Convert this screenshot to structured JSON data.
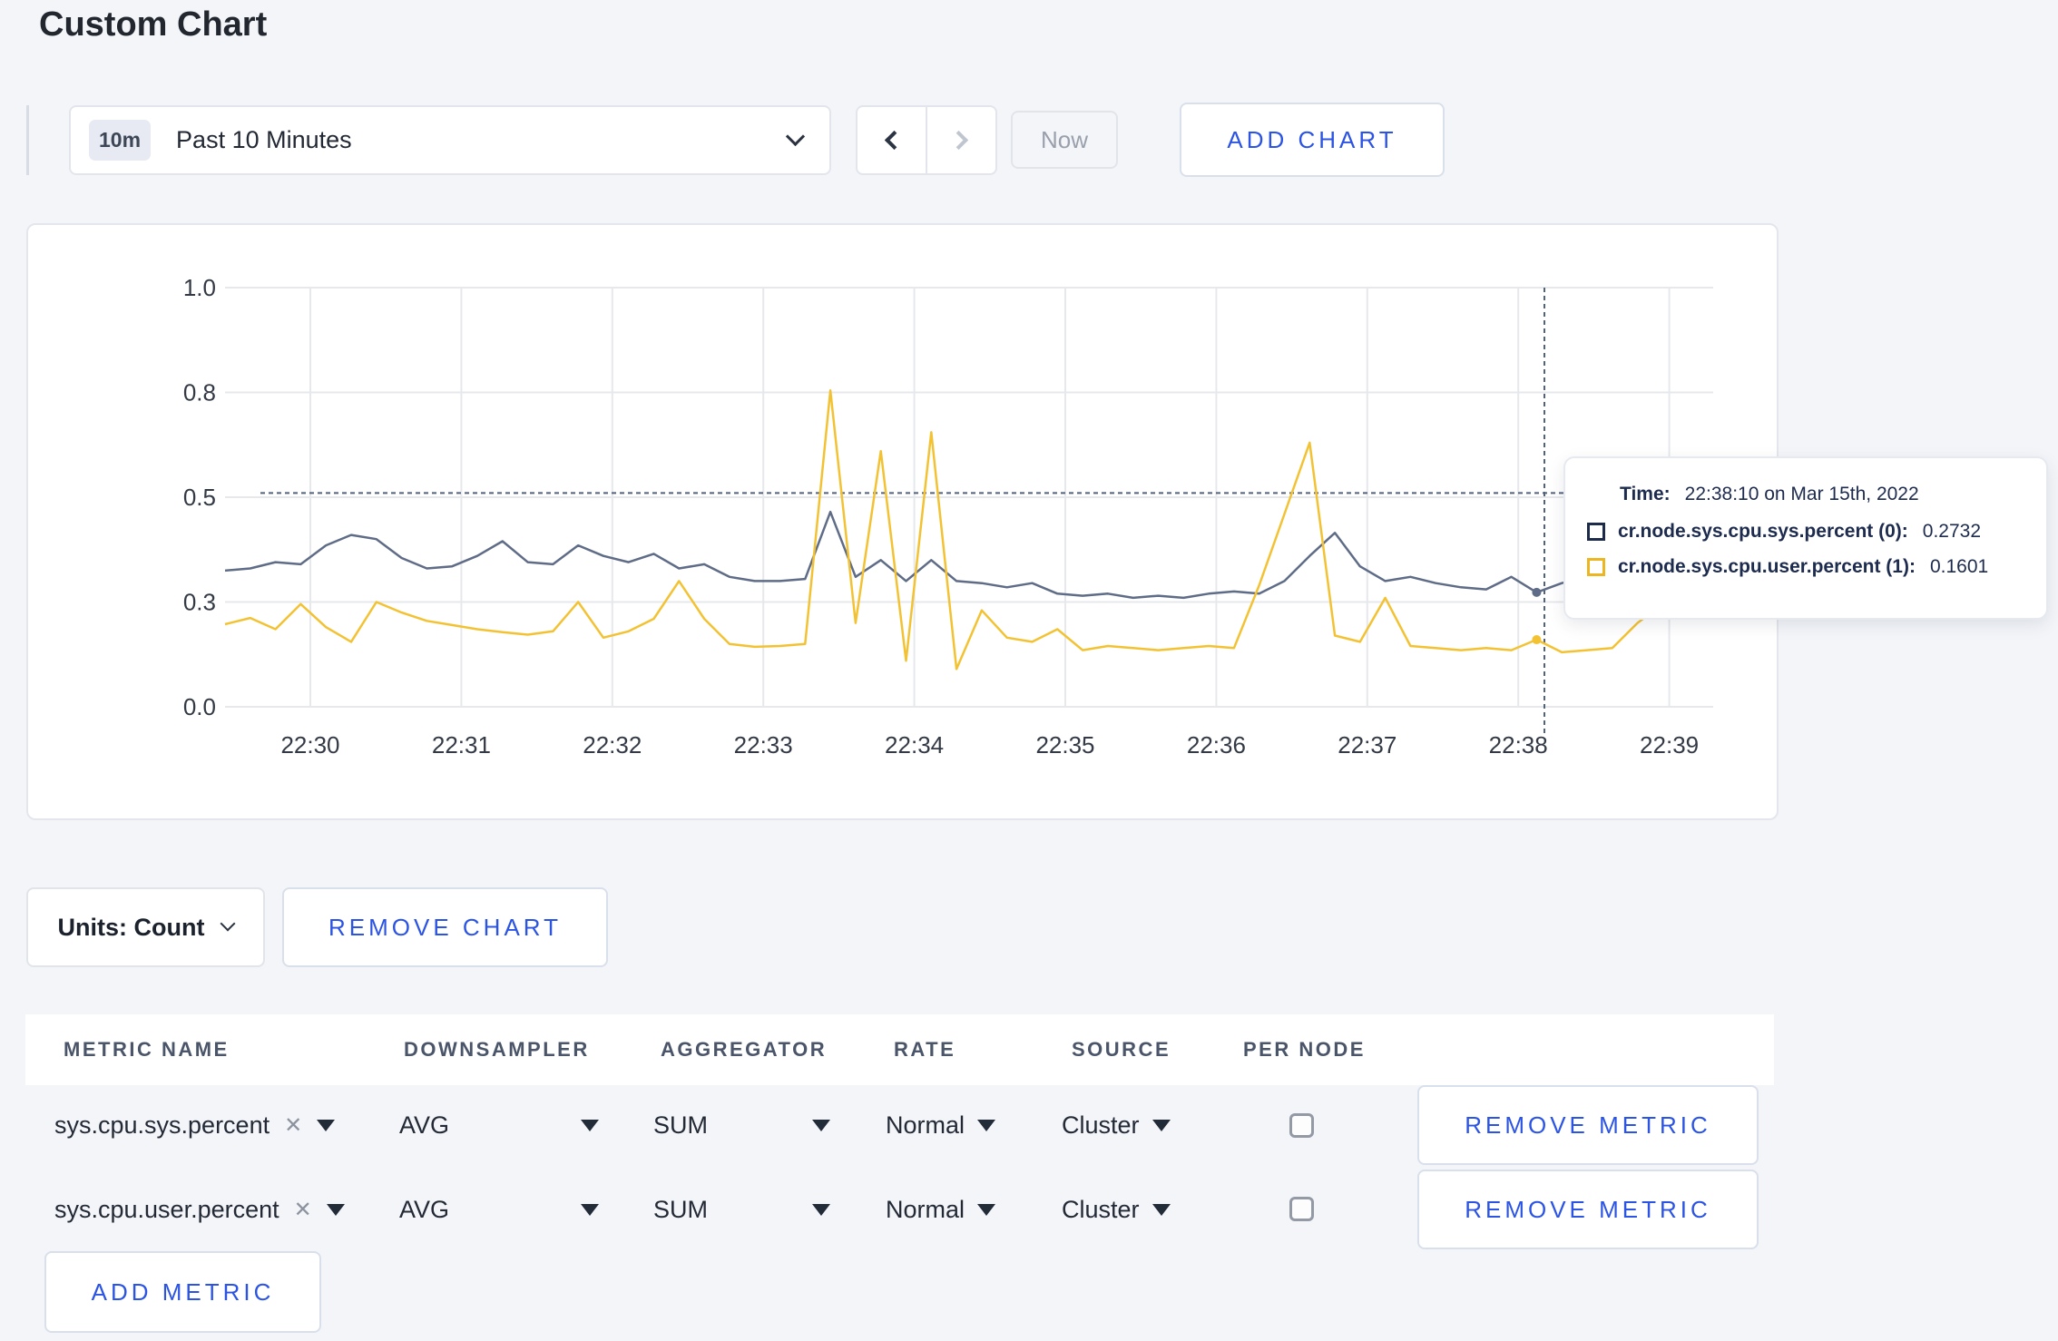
{
  "page": {
    "title": "Custom Chart"
  },
  "toolbar": {
    "time_range": {
      "badge": "10m",
      "label": "Past 10 Minutes"
    },
    "now_label": "Now",
    "add_chart_label": "ADD CHART"
  },
  "chart_controls": {
    "units_label": "Units: Count",
    "remove_chart_label": "REMOVE CHART",
    "add_metric_label": "ADD METRIC"
  },
  "tooltip": {
    "time_label": "Time:",
    "time_value": "22:38:10 on Mar 15th, 2022",
    "series": [
      {
        "name": "cr.node.sys.cpu.sys.percent (0):",
        "value": "0.2732",
        "color": "#1c2b4a"
      },
      {
        "name": "cr.node.sys.cpu.user.percent (1):",
        "value": "0.1601",
        "color": "#edb620"
      }
    ]
  },
  "metrics_table": {
    "headers": [
      "METRIC NAME",
      "DOWNSAMPLER",
      "AGGREGATOR",
      "RATE",
      "SOURCE",
      "PER NODE"
    ],
    "remove_metric_label": "REMOVE METRIC",
    "rows": [
      {
        "metric_name": "sys.cpu.sys.percent",
        "downsampler": "AVG",
        "aggregator": "SUM",
        "rate": "Normal",
        "source": "Cluster",
        "per_node_checked": false
      },
      {
        "metric_name": "sys.cpu.user.percent",
        "downsampler": "AVG",
        "aggregator": "SUM",
        "rate": "Normal",
        "source": "Cluster",
        "per_node_checked": false
      }
    ]
  },
  "chart_data": {
    "type": "line",
    "x_start": "22:29:20",
    "x_interval_seconds": 10,
    "x_tick_labels": [
      "22:30",
      "22:31",
      "22:32",
      "22:33",
      "22:34",
      "22:35",
      "22:36",
      "22:37",
      "22:38",
      "22:39"
    ],
    "y_tick_labels": [
      "1.0",
      "0.8",
      "0.5",
      "0.3",
      "0.0"
    ],
    "y_tick_values": [
      1.0,
      0.75,
      0.5,
      0.25,
      0.0
    ],
    "ylim": [
      0,
      1
    ],
    "grid": true,
    "crosshair": {
      "time": "22:38:10",
      "hline_value": 0.51,
      "point_index": 52
    },
    "series": [
      {
        "name": "cr.node.sys.cpu.sys.percent",
        "color": "#5f6c87",
        "values": [
          0.325,
          0.33,
          0.345,
          0.34,
          0.385,
          0.41,
          0.4,
          0.355,
          0.33,
          0.335,
          0.36,
          0.395,
          0.345,
          0.34,
          0.385,
          0.36,
          0.345,
          0.365,
          0.33,
          0.34,
          0.31,
          0.3,
          0.3,
          0.305,
          0.465,
          0.31,
          0.35,
          0.3,
          0.35,
          0.3,
          0.295,
          0.285,
          0.295,
          0.27,
          0.265,
          0.27,
          0.26,
          0.265,
          0.26,
          0.27,
          0.275,
          0.27,
          0.3,
          0.36,
          0.415,
          0.335,
          0.3,
          0.31,
          0.295,
          0.285,
          0.28,
          0.31,
          0.273,
          0.295,
          0.31,
          0.29,
          0.285,
          0.295,
          0.3,
          0.305
        ]
      },
      {
        "name": "cr.node.sys.cpu.user.percent",
        "color": "#f3c233",
        "values": [
          0.197,
          0.212,
          0.185,
          0.245,
          0.19,
          0.155,
          0.25,
          0.225,
          0.205,
          0.195,
          0.185,
          0.178,
          0.172,
          0.18,
          0.25,
          0.165,
          0.18,
          0.21,
          0.3,
          0.21,
          0.15,
          0.143,
          0.145,
          0.15,
          0.755,
          0.2,
          0.61,
          0.11,
          0.655,
          0.09,
          0.23,
          0.165,
          0.155,
          0.185,
          0.135,
          0.145,
          0.14,
          0.135,
          0.14,
          0.145,
          0.14,
          0.29,
          0.46,
          0.63,
          0.17,
          0.155,
          0.26,
          0.145,
          0.14,
          0.135,
          0.14,
          0.135,
          0.1601,
          0.13,
          0.135,
          0.14,
          0.2,
          0.245,
          0.23,
          0.22
        ]
      }
    ]
  }
}
